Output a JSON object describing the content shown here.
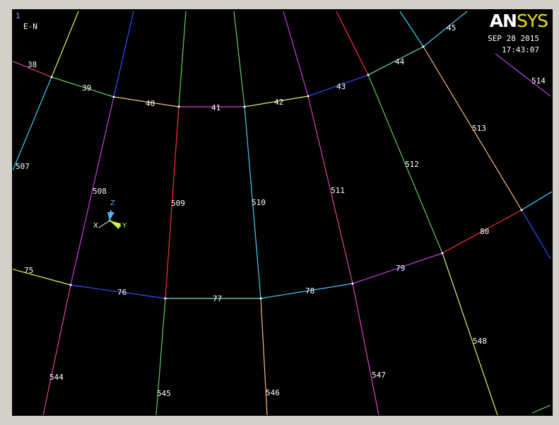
{
  "header": {
    "window_number": "1",
    "plot_mode": "E-N",
    "date": "SEP 28 2015",
    "time": "17:43:07",
    "logo_an": "AN",
    "logo_sys": "SYS"
  },
  "triad": {
    "z": "Z",
    "x": "X",
    "y": "Y"
  },
  "colors": {
    "background": "#000000",
    "label": "#ffffff",
    "node": "#ffffff",
    "triad_z": "#4fb3ff",
    "triad_y": "#c8ff40",
    "triad_x": "#ffffff"
  },
  "element_labels": [
    "38",
    "39",
    "40",
    "41",
    "42",
    "43",
    "44",
    "45",
    "507",
    "508",
    "509",
    "510",
    "511",
    "512",
    "513",
    "514",
    "75",
    "76",
    "77",
    "78",
    "79",
    "80",
    "544",
    "545",
    "546",
    "547",
    "548"
  ]
}
